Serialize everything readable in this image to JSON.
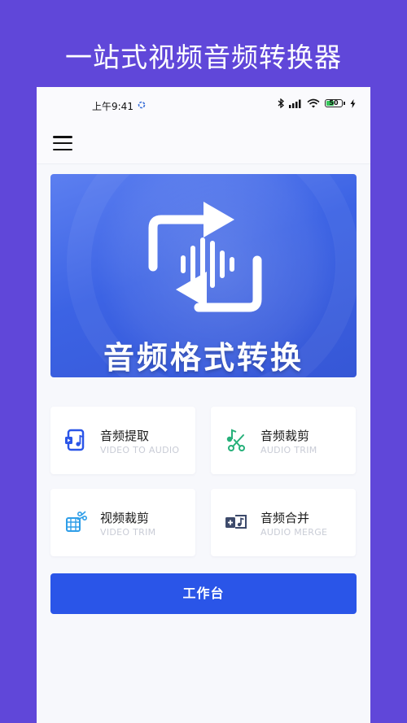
{
  "promo": {
    "title": "一站式视频音频转换器"
  },
  "status_bar": {
    "time": "上午9:41",
    "battery_level": "50",
    "battery_fraction": 0.5
  },
  "banner": {
    "title": "音频格式转换"
  },
  "cards": [
    {
      "title": "音频提取",
      "subtitle": "VIDEO TO AUDIO",
      "icon": "video-to-audio-icon"
    },
    {
      "title": "音频裁剪",
      "subtitle": "AUDIO TRIM",
      "icon": "audio-trim-icon"
    },
    {
      "title": "视频裁剪",
      "subtitle": "VIDEO TRIM",
      "icon": "video-trim-icon"
    },
    {
      "title": "音频合并",
      "subtitle": "AUDIO MERGE",
      "icon": "audio-merge-icon"
    }
  ],
  "workbench": {
    "label": "工作台"
  },
  "colors": {
    "background": "#6047d9",
    "primary": "#2a55e8",
    "banner": "#3c63e4"
  }
}
